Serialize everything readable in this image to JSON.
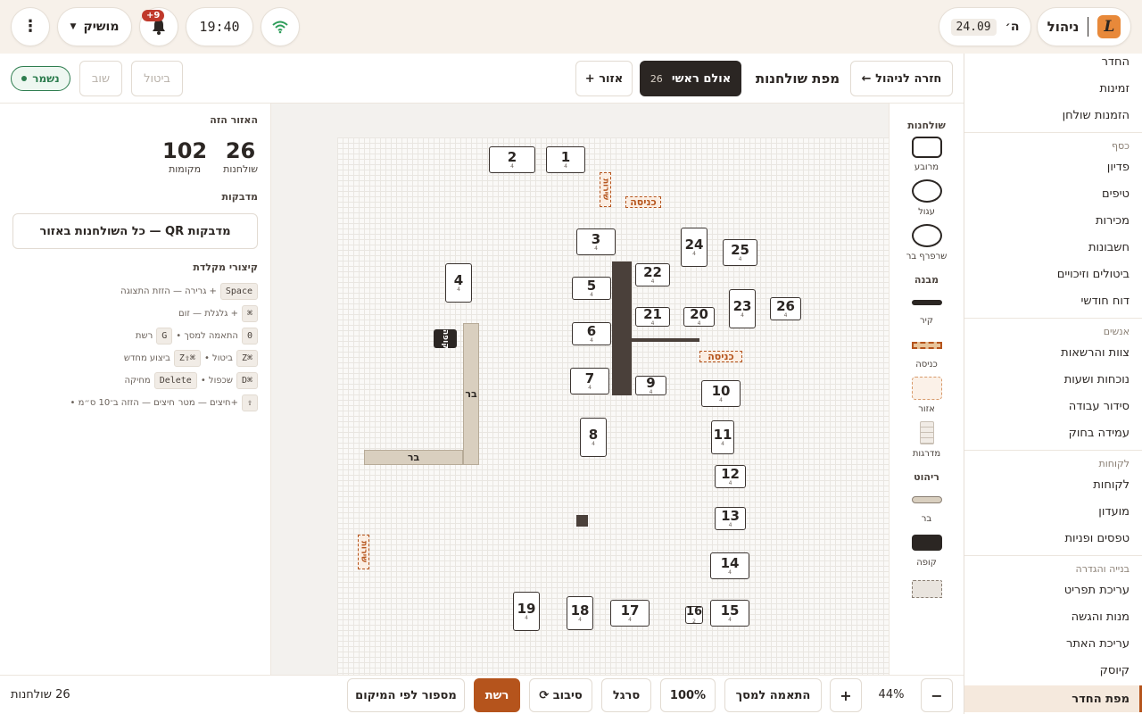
{
  "topbar": {
    "brand_label": "ניהול",
    "day_label": "ה׳",
    "date_label": "24.09",
    "time_label": "19:40",
    "notif_badge": "+9",
    "mode_label": "מושיק"
  },
  "sidebar": {
    "top_items": [
      "החדר",
      "זמינות",
      "הזמנות שולחן"
    ],
    "sections": [
      {
        "title": "כסף",
        "items": [
          "פדיון",
          "טיפים",
          "מכירות",
          "חשבונות",
          "ביטולים וזיכויים",
          "דוח חודשי"
        ]
      },
      {
        "title": "אנשים",
        "items": [
          "צוות והרשאות",
          "נוכחות ושעות",
          "סידור עבודה",
          "עמידה בחוק"
        ]
      },
      {
        "title": "לקוחות",
        "items": [
          "לקוחות",
          "מועדון",
          "טפסים ופניות"
        ]
      },
      {
        "title": "בנייה והגדרה",
        "items": [
          "עריכת תפריט",
          "מנות והגשה",
          "עריכת האתר",
          "קיוסק"
        ]
      }
    ],
    "active_item": "מפת החדר"
  },
  "toolbar": {
    "back_label": "← חזרה לניהול",
    "title": "מפת שולחנות",
    "room_label": "אולם ראשי",
    "room_count": "26",
    "add_zone_label": "+ אזור",
    "cancel_label": "ביטול",
    "redo_label": "שוב",
    "saved_label": "נשמר"
  },
  "leftpanel": {
    "zone_title": "האזור הזה",
    "tables_count": "26",
    "tables_label": "שולחנות",
    "seats_count": "102",
    "seats_label": "מקומות",
    "stickers_title": "מדבקות",
    "qr_button_label": "מדבקות QR — כל השולחנות באזור",
    "shortcuts_title": "קיצורי מקלדת",
    "shortcuts": [
      {
        "parts": [
          {
            "k": "Space"
          },
          {
            "t": "+ גרירה — הזזת התצוגה"
          }
        ]
      },
      {
        "parts": [
          {
            "k": "⌘"
          },
          {
            "t": "+ גלגלת — זום"
          }
        ]
      },
      {
        "parts": [
          {
            "k": "0"
          },
          {
            "t": "התאמה למסך •"
          },
          {
            "k": "G"
          },
          {
            "t": "רשת"
          }
        ]
      },
      {
        "parts": [
          {
            "k": "⌘Z"
          },
          {
            "t": "ביטול •"
          },
          {
            "k": "⌘⇧Z"
          },
          {
            "t": "ביצוע מחדש"
          }
        ]
      },
      {
        "parts": [
          {
            "k": "⌘D"
          },
          {
            "t": "שכפול •"
          },
          {
            "k": "Delete"
          },
          {
            "t": "מחיקה"
          }
        ]
      },
      {
        "parts": [
          {
            "k": "⇧"
          },
          {
            "t": "+חיצים — מטר"
          },
          {
            "t": "חיצים — הזזה ב־10 ס״מ •"
          }
        ]
      }
    ]
  },
  "palette": {
    "tables_title": "שולחנות",
    "tables_items": [
      "מרובע",
      "עגול",
      "שרפרף בר"
    ],
    "structure_title": "מבנה",
    "structure_items": [
      "קיר",
      "כניסה",
      "אזור",
      "מדרגות"
    ],
    "furniture_title": "ריהוט",
    "furniture_items": [
      "בר",
      "קופה"
    ]
  },
  "canvas": {
    "tables": [
      {
        "n": "1",
        "s": "4"
      },
      {
        "n": "2",
        "s": "4"
      },
      {
        "n": "3",
        "s": "4"
      },
      {
        "n": "4",
        "s": "4"
      },
      {
        "n": "5",
        "s": "4"
      },
      {
        "n": "6",
        "s": "4"
      },
      {
        "n": "7",
        "s": "4"
      },
      {
        "n": "8",
        "s": "4"
      },
      {
        "n": "9",
        "s": "4"
      },
      {
        "n": "10",
        "s": "4"
      },
      {
        "n": "11",
        "s": "4"
      },
      {
        "n": "12",
        "s": "4"
      },
      {
        "n": "13",
        "s": "4"
      },
      {
        "n": "14",
        "s": "4"
      },
      {
        "n": "15",
        "s": "4"
      },
      {
        "n": "16",
        "s": "2"
      },
      {
        "n": "17",
        "s": "4"
      },
      {
        "n": "18",
        "s": "4"
      },
      {
        "n": "19",
        "s": "4"
      },
      {
        "n": "20",
        "s": "4"
      },
      {
        "n": "21",
        "s": "4"
      },
      {
        "n": "22",
        "s": "4"
      },
      {
        "n": "23",
        "s": "4"
      },
      {
        "n": "24",
        "s": "4"
      },
      {
        "n": "25",
        "s": "4"
      },
      {
        "n": "26",
        "s": "4"
      }
    ],
    "entrance_label": "כניסה",
    "service_label": "שירות",
    "bar_label": "בר",
    "register_label": "קופה"
  },
  "bottombar": {
    "count_label": "26 שולחנות",
    "zoom_label": "44%",
    "fit_label": "התאמה למסך",
    "zoom100_label": "100%",
    "ruler_label": "סרגל",
    "rotate_label": "⟳ סיבוב",
    "grid_label": "רשת",
    "renumber_label": "מספור לפי המיקום"
  },
  "colors": {
    "accent": "#b5541c",
    "dark": "#2b2623",
    "saved_green": "#2e7d4f"
  }
}
